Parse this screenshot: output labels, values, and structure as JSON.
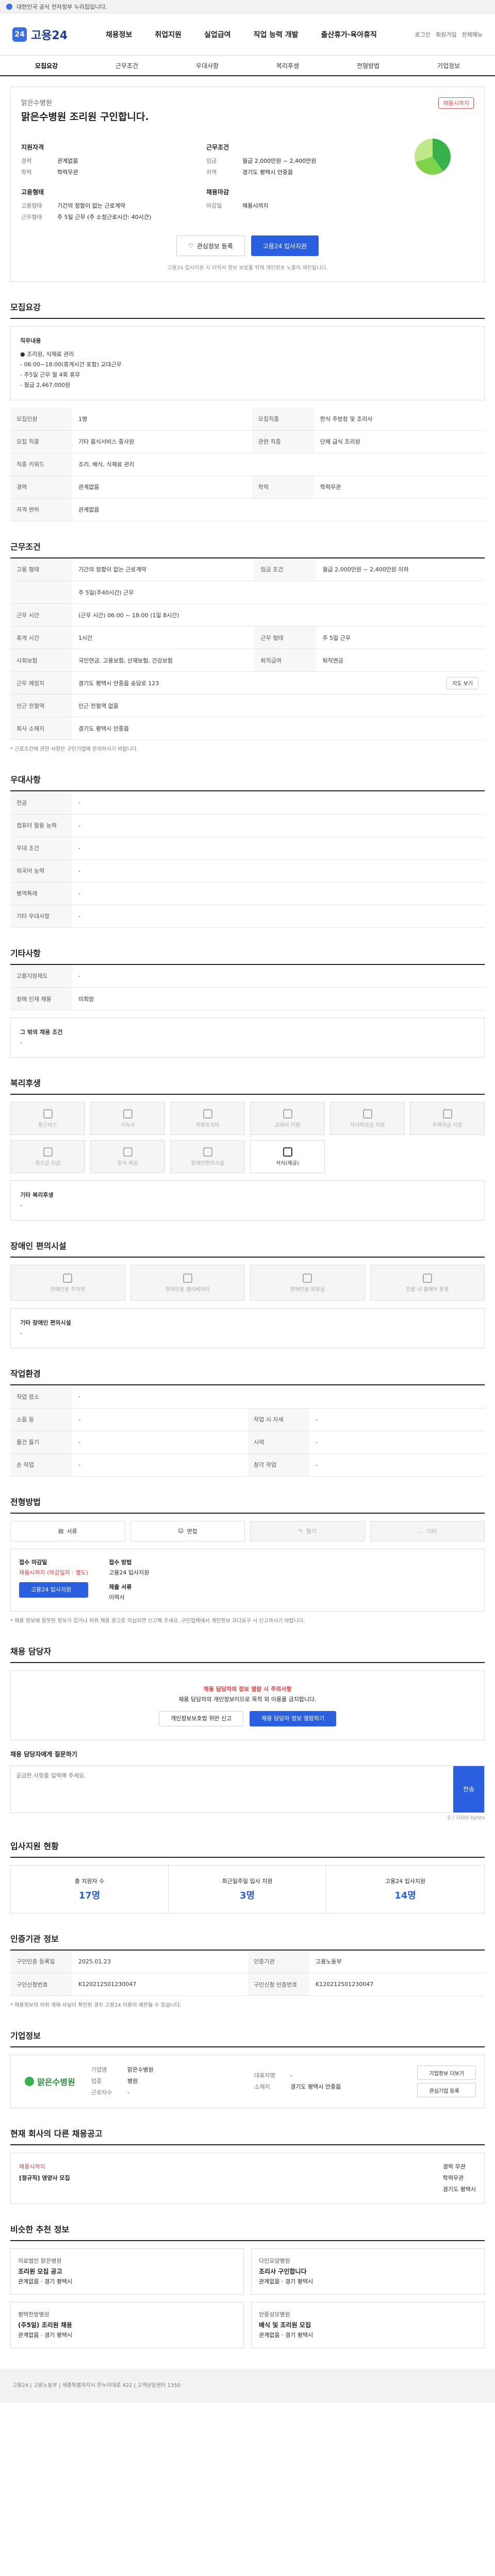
{
  "topbar": {
    "text": "대한민국 공식 전자정부 누리집입니다."
  },
  "header": {
    "brand": "고용24",
    "nav": [
      "채용정보",
      "취업지원",
      "실업급여",
      "직업 능력 개발",
      "출산휴가·육아휴직"
    ],
    "right": [
      "로그인",
      "회원가입",
      "전체메뉴"
    ]
  },
  "subnav": [
    "모집요강",
    "근무조건",
    "우대사항",
    "복리후생",
    "전형방법",
    "기업정보"
  ],
  "job": {
    "company": "맑은수병원",
    "title": "맑은수병원 조리원 구인합니다.",
    "badge": "채용시까지",
    "left_head": "지원자격",
    "left": [
      {
        "k": "경력",
        "v": "관계없음"
      },
      {
        "k": "학력",
        "v": "학력무관"
      }
    ],
    "right_head": "근무조건",
    "right": [
      {
        "k": "임금",
        "v": "월급 2,000만원 ~ 2,400만원"
      },
      {
        "k": "지역",
        "v": "경기도 평택시 안중읍"
      }
    ],
    "left2_head": "고용형태",
    "left2": [
      {
        "k": "고용형태",
        "v": "기간의 정함이 없는 근로계약"
      },
      {
        "k": "근무형태",
        "v": "주 5일 근무 (주 소정근로시간: 40시간)"
      }
    ],
    "right2_head": "채용마감",
    "right2": [
      {
        "k": "마감일",
        "v": "채용시까지"
      }
    ]
  },
  "buttons": {
    "scrap": "관심정보 등록",
    "apply": "고용24 입사지원"
  },
  "apply_note": "고용24 입사지원 시 이력서 정보 보호를 위해 개인정보 노출이 제한됩니다.",
  "sections": {
    "recruit": {
      "title": "모집요강",
      "desc_head": "직무내용",
      "desc": [
        "● 조리원, 식재료 관리",
        "- 06:00~18:00(휴게시간 포함) 교대근무",
        "- 주5일 근무 월 4회 휴무",
        "- 월급 2,467,000원"
      ],
      "rows": [
        [
          "모집인원",
          "1명",
          "모집직종",
          "한식 주방장 및 조리사"
        ],
        [
          "모집 직종",
          "기타 음식서비스 종사원",
          "관련 직종",
          "단체 급식 조리원"
        ],
        [
          "직종 키워드",
          "조리, 배식, 식재료 관리",
          "",
          ""
        ],
        [
          "경력",
          "관계없음",
          "학력",
          "학력무관"
        ],
        [
          "자격 면허",
          "관계없음",
          "",
          ""
        ]
      ]
    },
    "conditions": {
      "title": "근무조건",
      "rows": [
        [
          "고용 형태",
          "기간의 정함이 없는 근로계약",
          "임금 조건",
          "월급 2,000만원 ~ 2,400만원 이하"
        ],
        [
          "",
          "주 5일(주40시간) 근무",
          "",
          ""
        ],
        [
          "근무 시간",
          "(근무 시간) 06:00 ~ 18:00 (1일 8시간)",
          "",
          ""
        ],
        [
          "휴게 시간",
          "1시간",
          "근무 형태",
          "주 5일 근무"
        ],
        [
          "사회보험",
          "국민연금, 고용보험, 산재보험, 건강보험",
          "퇴직급여",
          "퇴직연금"
        ],
        [
          "근무 예정지",
          "경기도 평택시 안중읍 송담로 123",
          "",
          ""
        ],
        [
          "인근 전철역",
          "인근 전철역 없음",
          "",
          ""
        ],
        [
          "회사 소재지",
          "경기도 평택시 안중읍",
          "",
          ""
        ]
      ],
      "map_label": "지도 보기",
      "footnote": "* 근로조건에 관한 사항은 구인기업에 문의하시기 바랍니다."
    },
    "prefs": {
      "title": "우대사항",
      "rows": [
        [
          "전공",
          "-"
        ],
        [
          "컴퓨터 활용 능력",
          "-"
        ],
        [
          "우대 조건",
          "-"
        ],
        [
          "외국어 능력",
          "-"
        ],
        [
          "병역특례",
          "-"
        ],
        [
          "기타 우대사항",
          "-"
        ]
      ]
    },
    "etc": {
      "title": "기타사항",
      "rows": [
        [
          "고용지원제도",
          "-"
        ],
        [
          "장애 인재 채용",
          "미희망"
        ]
      ],
      "note_head": "그 밖의 채용 조건",
      "note": "-"
    },
    "welfare": {
      "title": "복리후생",
      "items": [
        "통근버스",
        "기숙사",
        "차량유지비",
        "교육비 지원",
        "자녀학자금 지원",
        "주택자금 지원",
        "경조금 지급",
        "중식 제공",
        "장애인편의시설",
        "석식(제공)"
      ],
      "etc_head": "기타 복리후생",
      "etc": "-"
    },
    "disabled": {
      "title": "장애인 편의시설",
      "items": [
        "장애인용 주차장",
        "장애인용 엘리베이터",
        "장애인용 화장실",
        "건물 내 휠체어 통행"
      ],
      "etc_head": "기타 장애인 편의시설",
      "etc": "-"
    },
    "workenv": {
      "title": "작업환경",
      "rows": [
        [
          "작업 장소",
          "-",
          "",
          ""
        ],
        [
          "소음 등",
          "-",
          "작업 시 자세",
          "-"
        ],
        [
          "물건 들기",
          "-",
          "시력",
          "-"
        ],
        [
          "손 작업",
          "-",
          "청각 작업",
          "-"
        ]
      ]
    },
    "selection": {
      "title": "전형방법",
      "steps": [
        "서류",
        "면접",
        "필기",
        "기타"
      ],
      "apply_head": "접수 마감일",
      "apply_val": "채용시까지 (마감일자 : 별도)",
      "method_head": "접수 방법",
      "method_val": "고용24 입사지원",
      "docs_head": "제출 서류",
      "docs_val": "이력서",
      "apply_btn": "고용24 입사지원",
      "warn": "* 채용 정보에 잘못된 정보가 있거나 허위 채용 광고로 의심되면 신고해 주세요. 구인업체에서 개인정보 과다요구 시 신고하시기 바랍니다."
    },
    "contact": {
      "title": "채용 담당자",
      "warn_title": "채용 담당자의 정보 열람 시 주의사항",
      "warn_body": "채용 담당자의 개인정보이므로 목적 외 이용을 금지합니다.",
      "btn1": "개인정보보호법 위반 신고",
      "btn2": "채용 담당자 정보 열람하기",
      "qa_head": "채용 담당자에게 질문하기",
      "qa_placeholder": "궁금한 사항을 입력해 주세요.",
      "qa_send": "전송",
      "qa_count": "0 / 1000 bytes"
    },
    "stats": {
      "title": "입사지원 현황",
      "items": [
        {
          "label": "총 지원자 수",
          "value": "17명"
        },
        {
          "label": "최근일주일 입사 지원",
          "value": "3명"
        },
        {
          "label": "고용24 입사지원",
          "value": "14명"
        }
      ]
    },
    "info": {
      "title": "인증기관 정보",
      "rows": [
        [
          "구인인증 등록일",
          "2025.01.23",
          "인증기관",
          "고용노동부"
        ],
        [
          "구인신청번호",
          "K120212501230047",
          "구인신청 인증번호",
          "K120212501230047"
        ]
      ],
      "warn": "* 채용정보의 허위 게재 사실이 확인된 경우 고용24 이용이 제한될 수 있습니다."
    },
    "company": {
      "title": "기업정보",
      "name": "맑은수병원",
      "rows": [
        [
          "기업명",
          "맑은수병원"
        ],
        [
          "업종",
          "병원"
        ],
        [
          "근로자수",
          "-"
        ],
        [
          "대표자명",
          "-"
        ],
        [
          "소재지",
          "경기도 평택시 안중읍"
        ]
      ],
      "btns": [
        "기업정보 더보기",
        "관심기업 등록"
      ]
    },
    "related": {
      "title": "현재 회사의 다른 채용공고",
      "tag": "채용시까지",
      "job": "[정규직] 영양사 모집",
      "meta": [
        "경력 무관",
        "학력무관",
        "경기도 평택시"
      ]
    },
    "similar": {
      "title": "비슷한 추천 정보",
      "jobs": [
        {
          "co": "의료법인 맑은병원",
          "t": "조리원 모집 공고",
          "m": "관계없음 · 경기 평택시"
        },
        {
          "co": "다인요양병원",
          "t": "조리사 구인합니다",
          "m": "관계없음 · 경기 평택시"
        },
        {
          "co": "평택한방병원",
          "t": "(주5일) 조리원 채용",
          "m": "관계없음 · 경기 평택시"
        },
        {
          "co": "안중성모병원",
          "t": "배식 및 조리원 모집",
          "m": "관계없음 · 경기 평택시"
        }
      ]
    }
  },
  "footer": "고용24 | 고용노동부 | 세종특별자치시 한누리대로 422 | 고객상담센터 1350"
}
